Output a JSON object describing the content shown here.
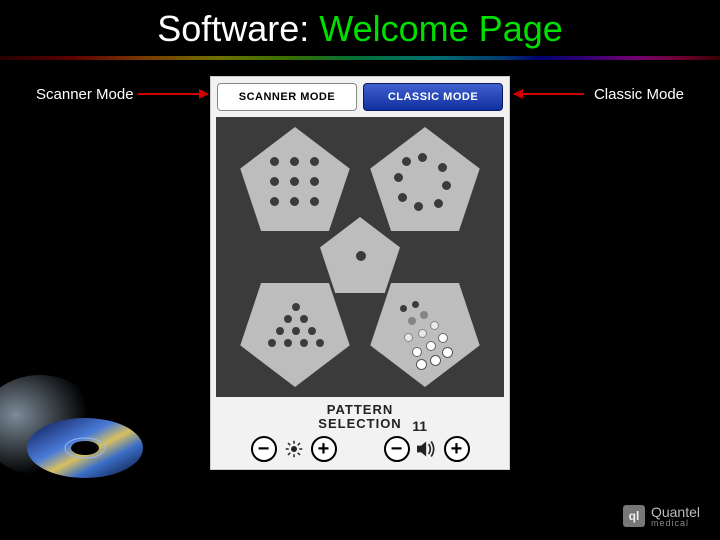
{
  "title": {
    "prefix": "Software: ",
    "highlight": "Welcome Page"
  },
  "annotations": {
    "left": "Scanner Mode",
    "right": "Classic Mode"
  },
  "device": {
    "tabs": {
      "scanner": "SCANNER MODE",
      "classic": "CLASSIC MODE"
    },
    "pattern_label_line1": "PATTERN",
    "pattern_label_line2": "SELECTION",
    "volume_value": "11",
    "controls": {
      "brightness_minus": "−",
      "brightness_plus": "+",
      "volume_minus": "−",
      "volume_plus": "+"
    }
  },
  "brand": {
    "name": "Quantel",
    "sub": "medical",
    "mark": "ql"
  }
}
